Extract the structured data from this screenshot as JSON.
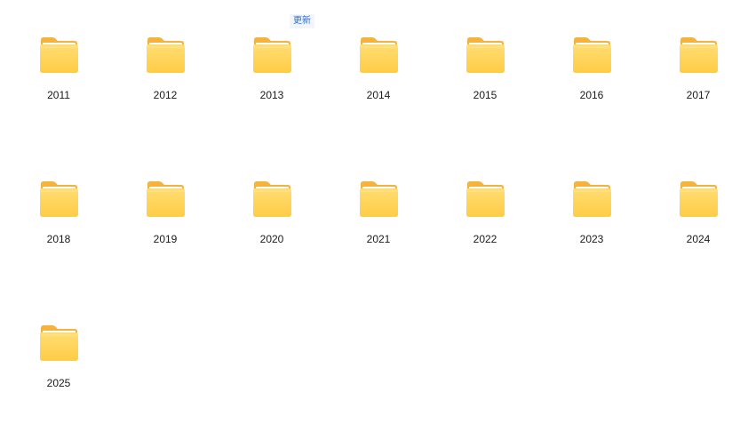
{
  "badge": {
    "label": "更新"
  },
  "folders": [
    {
      "label": "2011"
    },
    {
      "label": "2012"
    },
    {
      "label": "2013"
    },
    {
      "label": "2014"
    },
    {
      "label": "2015"
    },
    {
      "label": "2016"
    },
    {
      "label": "2017"
    },
    {
      "label": "2018"
    },
    {
      "label": "2019"
    },
    {
      "label": "2020"
    },
    {
      "label": "2021"
    },
    {
      "label": "2022"
    },
    {
      "label": "2023"
    },
    {
      "label": "2024"
    },
    {
      "label": "2025"
    }
  ],
  "icon": "folder-icon",
  "colors": {
    "folder_back": "#F5B33C",
    "folder_front_top": "#FFDD72",
    "folder_front_bottom": "#FFCC45",
    "paper": "#FFFFFF",
    "badge_text": "#2A6FC9"
  }
}
